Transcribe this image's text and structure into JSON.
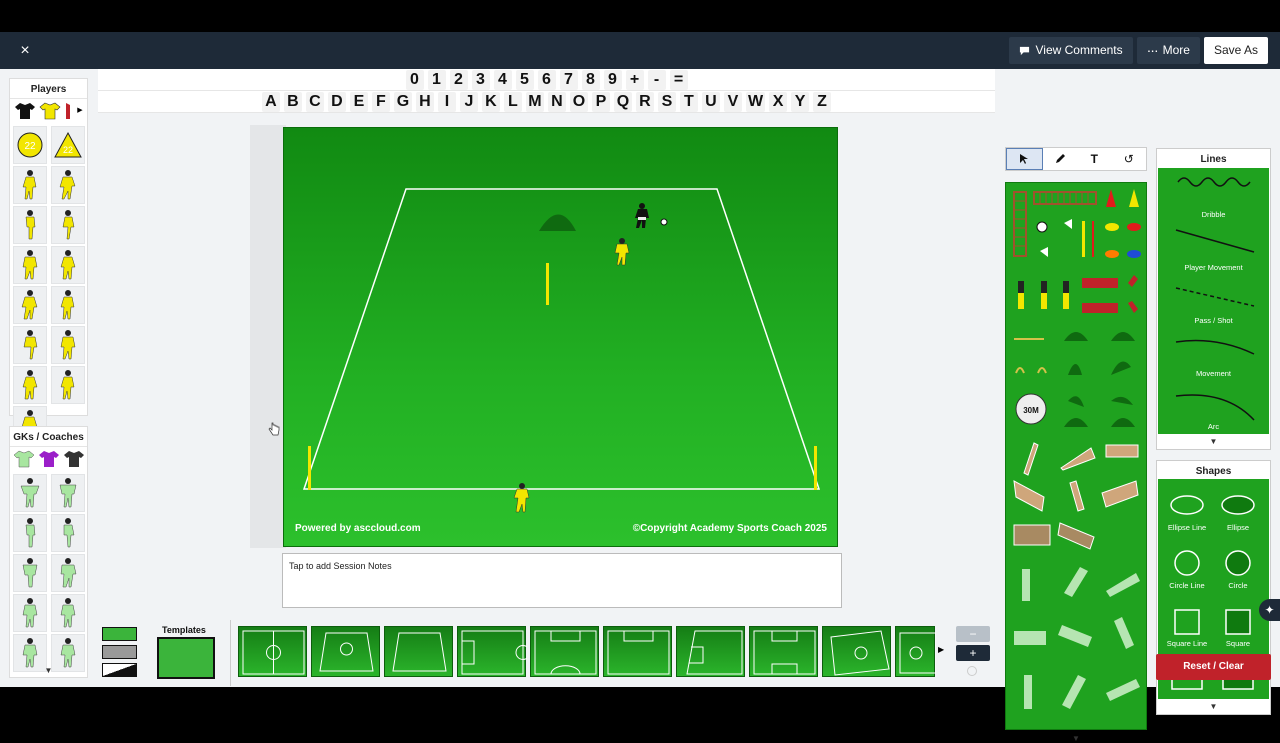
{
  "topbar": {
    "close_glyph": "×",
    "view_comments_label": "View Comments",
    "more_label": "More",
    "save_as_label": "Save As"
  },
  "keys": {
    "numbers": [
      "0",
      "1",
      "2",
      "3",
      "4",
      "5",
      "6",
      "7",
      "8",
      "9",
      "+",
      "-",
      "="
    ],
    "letters": [
      "A",
      "B",
      "C",
      "D",
      "E",
      "F",
      "G",
      "H",
      "I",
      "J",
      "K",
      "L",
      "M",
      "N",
      "O",
      "P",
      "Q",
      "R",
      "S",
      "T",
      "U",
      "V",
      "W",
      "X",
      "Y",
      "Z"
    ]
  },
  "left_panels": {
    "players_title": "Players",
    "players_marker_number": "22",
    "gks_title": "GKs / Coaches"
  },
  "pitch": {
    "powered_by": "Powered by asccloud.com",
    "copyright": "©Copyright Academy Sports Coach 2025"
  },
  "notes": {
    "placeholder": "Tap to add Session Notes"
  },
  "templates": {
    "label": "Templates"
  },
  "equipment": {
    "timer_label": "30M"
  },
  "lines": {
    "title": "Lines",
    "items": [
      "Dribble",
      "Player Movement",
      "Pass / Shot",
      "Movement",
      "Arc"
    ]
  },
  "shapes": {
    "title": "Shapes",
    "items": [
      "Ellipse Line",
      "Ellipse",
      "Circle Line",
      "Circle",
      "Square Line",
      "Square"
    ]
  },
  "reset_label": "Reset / Clear",
  "zoom": {
    "minus": "−",
    "plus": "+"
  },
  "colors": {
    "topbar": "#1e2a38",
    "pitch_green": "#22b023",
    "panel_green": "#1fa21f",
    "reset_red": "#c0222a",
    "player_yellow": "#f2e600"
  }
}
